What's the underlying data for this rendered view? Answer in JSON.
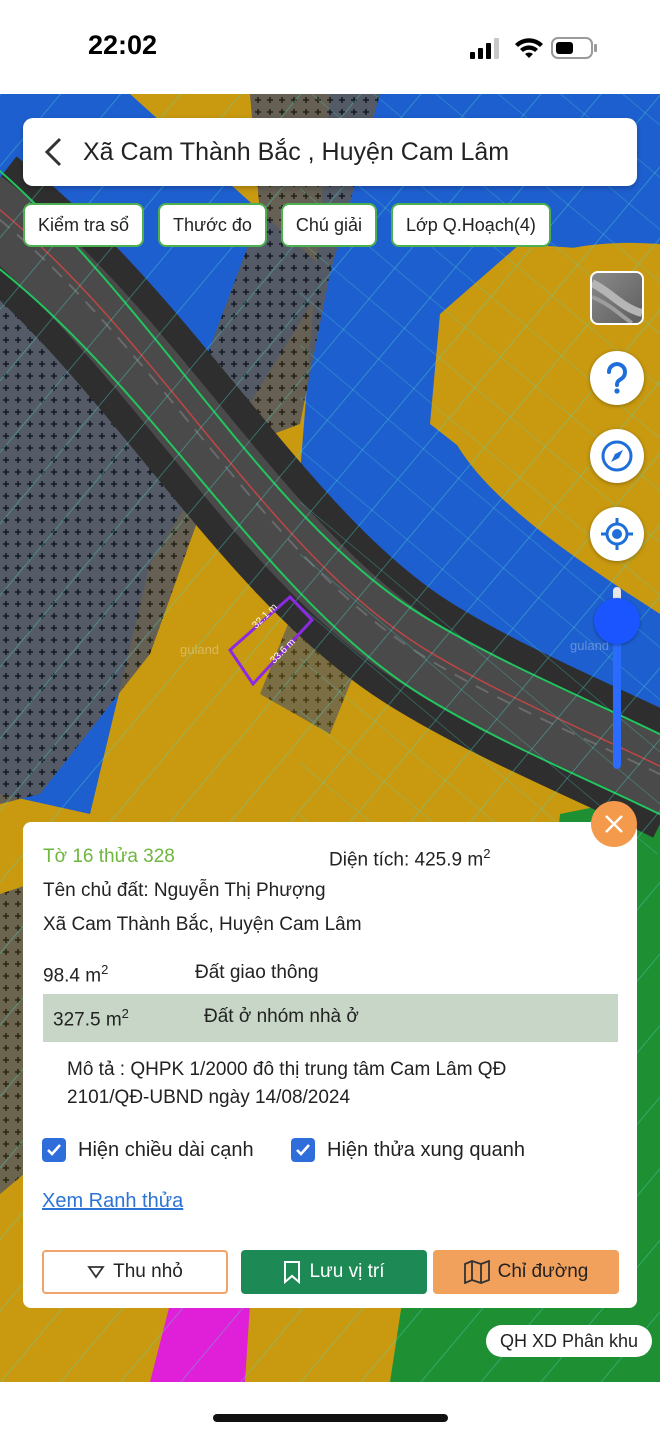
{
  "status_bar": {
    "time": "22:02"
  },
  "header": {
    "title": "Xã Cam Thành Bắc , Huyện Cam Lâm"
  },
  "toolbar": {
    "check_book": "Kiểm tra sổ",
    "ruler": "Thước đo",
    "legend": "Chú giải",
    "plan_layer": "Lớp Q.Hoạch(4)"
  },
  "map": {
    "dim_side_1": "32.1 m",
    "dim_side_2": "33.6 m",
    "watermark": "guland"
  },
  "panel": {
    "parcel_id": "Tờ 16 thửa 328",
    "area_label": "Diện tích: 425.9 m",
    "area_sup": "2",
    "owner": "Tên chủ đất: Nguyễn Thị Phượng",
    "address": "Xã Cam Thành Bắc, Huyện Cam Lâm",
    "land_uses": [
      {
        "area": "98.4 m",
        "sup": "2",
        "type": "Đất giao thông"
      },
      {
        "area": "327.5 m",
        "sup": "2",
        "type": "Đất ở nhóm nhà ở"
      }
    ],
    "description": "Mô tả : QHPK 1/2000 đô thị trung tâm Cam Lâm QĐ 2101/QĐ-UBND ngày 14/08/2024",
    "show_edge_length": "Hiện chiều dài cạnh",
    "show_neighbors": "Hiện thửa xung quanh",
    "view_boundary_link": "Xem Ranh thửa",
    "collapse_button": "Thu nhỏ",
    "save_button": "Lưu vị trí",
    "directions_button": "Chỉ đường"
  },
  "plan_badge": "QH XD Phân khu",
  "colors": {
    "planning_blue": "#1e5fd0",
    "residential_yellow": "#c99a10",
    "road_gray": "#3d3d3d",
    "accent_green": "#1d8a56",
    "accent_orange": "#f2a15c",
    "link_blue": "#2b74d6",
    "parcel_outline": "#8a2be2"
  }
}
